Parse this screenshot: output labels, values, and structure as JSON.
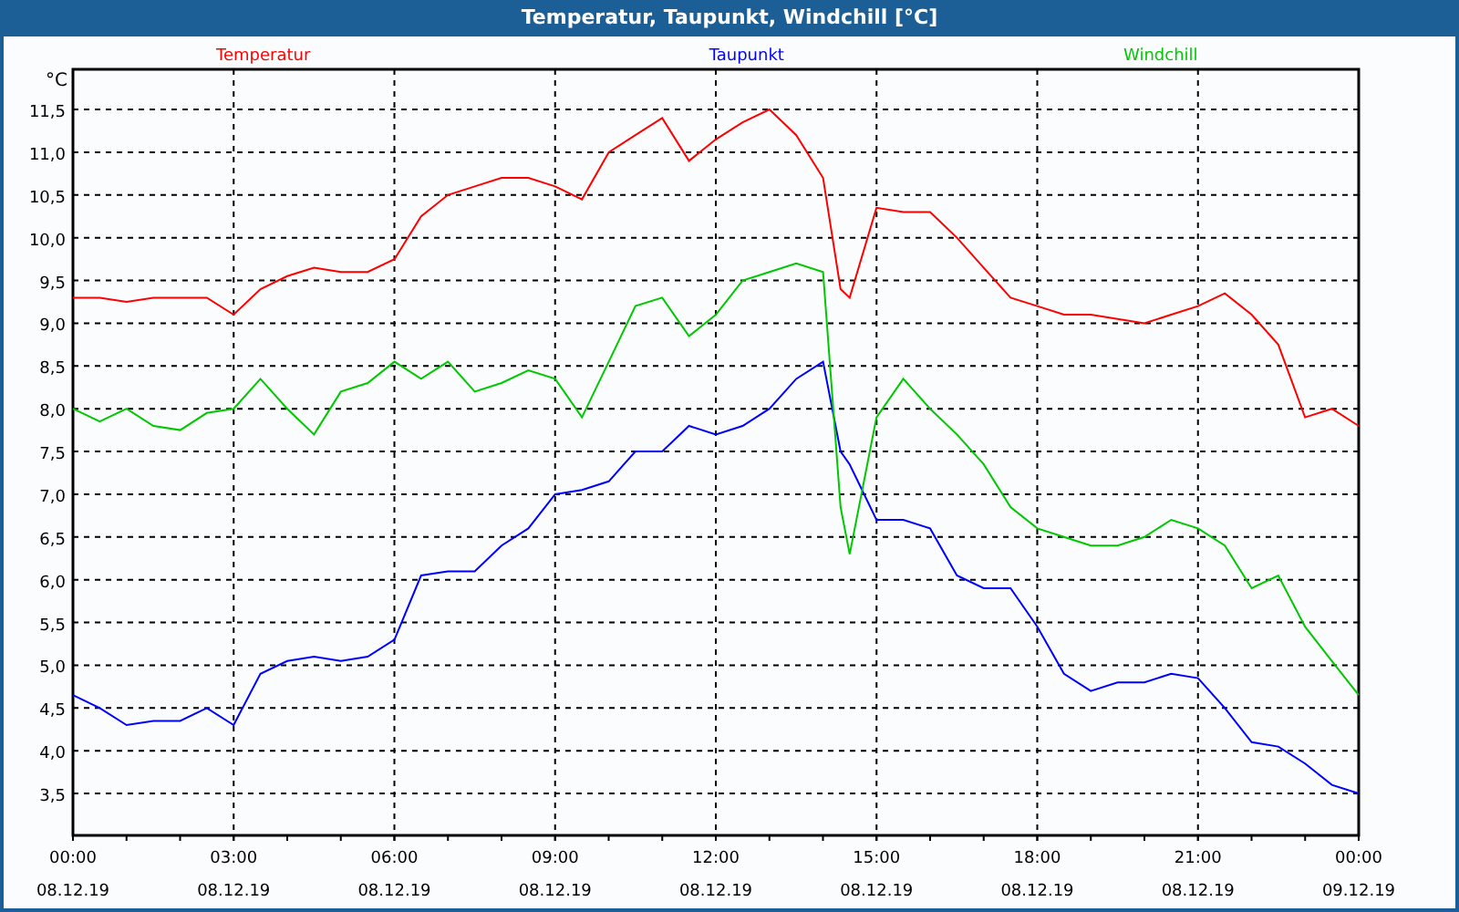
{
  "window": {
    "title": "Temperatur, Taupunkt, Windchill [°C]"
  },
  "chart_data": {
    "type": "line",
    "grid": true,
    "ylabel": "°C",
    "xlim": [
      0,
      24
    ],
    "ylim": [
      3.01,
      11.97
    ],
    "x": [
      0,
      0.5,
      1,
      1.5,
      2,
      2.5,
      3,
      3.5,
      4,
      4.5,
      5,
      5.5,
      6,
      6.5,
      7,
      7.5,
      8,
      8.5,
      9,
      9.5,
      10,
      10.5,
      11,
      11.5,
      12,
      12.5,
      13,
      13.5,
      14,
      14.33,
      14.5,
      15,
      15.5,
      16,
      16.5,
      17,
      17.5,
      18,
      18.5,
      19,
      19.5,
      20,
      20.5,
      21,
      21.5,
      22,
      22.5,
      23,
      23.5,
      24
    ],
    "series": [
      {
        "name": "Temperatur",
        "color": "#ff0000",
        "values": [
          9.3,
          9.3,
          9.25,
          9.3,
          9.3,
          9.3,
          9.1,
          9.4,
          9.55,
          9.65,
          9.6,
          9.6,
          9.75,
          10.25,
          10.5,
          10.6,
          10.7,
          10.7,
          10.6,
          10.45,
          11.0,
          11.2,
          11.4,
          10.9,
          11.15,
          11.35,
          11.5,
          11.2,
          10.7,
          9.4,
          9.3,
          10.35,
          10.3,
          10.3,
          10.0,
          9.65,
          9.3,
          9.2,
          9.1,
          9.1,
          9.05,
          9.0,
          9.1,
          9.2,
          9.35,
          9.1,
          8.75,
          7.9,
          8.0,
          7.8
        ]
      },
      {
        "name": "Taupunkt",
        "color": "#0000ff",
        "values": [
          4.65,
          4.5,
          4.3,
          4.35,
          4.35,
          4.5,
          4.3,
          4.9,
          5.05,
          5.1,
          5.05,
          5.1,
          5.3,
          6.05,
          6.1,
          6.1,
          6.4,
          6.6,
          7.0,
          7.05,
          7.15,
          7.5,
          7.5,
          7.8,
          7.7,
          7.8,
          8.0,
          8.35,
          8.55,
          7.5,
          7.35,
          6.7,
          6.7,
          6.6,
          6.05,
          5.9,
          5.9,
          5.45,
          4.9,
          4.7,
          4.8,
          4.8,
          4.9,
          4.85,
          4.5,
          4.1,
          4.05,
          3.85,
          3.6,
          3.5
        ]
      },
      {
        "name": "Windchill",
        "color": "#00c800",
        "values": [
          8.0,
          7.85,
          8.0,
          7.8,
          7.75,
          7.95,
          8.0,
          8.35,
          8.0,
          7.7,
          8.2,
          8.3,
          8.55,
          8.35,
          8.55,
          8.2,
          8.3,
          8.45,
          8.35,
          7.9,
          8.55,
          9.2,
          9.3,
          8.85,
          9.1,
          9.5,
          9.6,
          9.7,
          9.6,
          6.85,
          6.3,
          7.9,
          8.35,
          8.0,
          7.7,
          7.35,
          6.85,
          6.6,
          6.5,
          6.4,
          6.4,
          6.5,
          6.7,
          6.6,
          6.4,
          5.9,
          6.05,
          5.45,
          5.05,
          4.65
        ]
      }
    ],
    "xticks": [
      {
        "value": 0,
        "label": "00:00"
      },
      {
        "value": 3,
        "label": "03:00"
      },
      {
        "value": 6,
        "label": "06:00"
      },
      {
        "value": 9,
        "label": "09:00"
      },
      {
        "value": 12,
        "label": "12:00"
      },
      {
        "value": 15,
        "label": "15:00"
      },
      {
        "value": 18,
        "label": "18:00"
      },
      {
        "value": 21,
        "label": "21:00"
      },
      {
        "value": 24,
        "label": "00:00"
      }
    ],
    "yticks": [
      {
        "value": 3.5,
        "label": "3,5"
      },
      {
        "value": 4,
        "label": "4,0"
      },
      {
        "value": 4.5,
        "label": "4,5"
      },
      {
        "value": 5,
        "label": "5,0"
      },
      {
        "value": 5.5,
        "label": "5,5"
      },
      {
        "value": 6,
        "label": "6,0"
      },
      {
        "value": 6.5,
        "label": "6,5"
      },
      {
        "value": 7,
        "label": "7,0"
      },
      {
        "value": 7.5,
        "label": "7,5"
      },
      {
        "value": 8,
        "label": "8,0"
      },
      {
        "value": 8.5,
        "label": "8,5"
      },
      {
        "value": 9,
        "label": "9,0"
      },
      {
        "value": 9.5,
        "label": "9,5"
      },
      {
        "value": 10,
        "label": "10,0"
      },
      {
        "value": 10.5,
        "label": "10,5"
      },
      {
        "value": 11,
        "label": "11,0"
      },
      {
        "value": 11.5,
        "label": "11,5"
      }
    ]
  },
  "x_axis_dates": [
    "08.12.19",
    "08.12.19",
    "08.12.19",
    "08.12.19",
    "08.12.19",
    "08.12.19",
    "08.12.19",
    "08.12.19",
    "09.12.19"
  ]
}
